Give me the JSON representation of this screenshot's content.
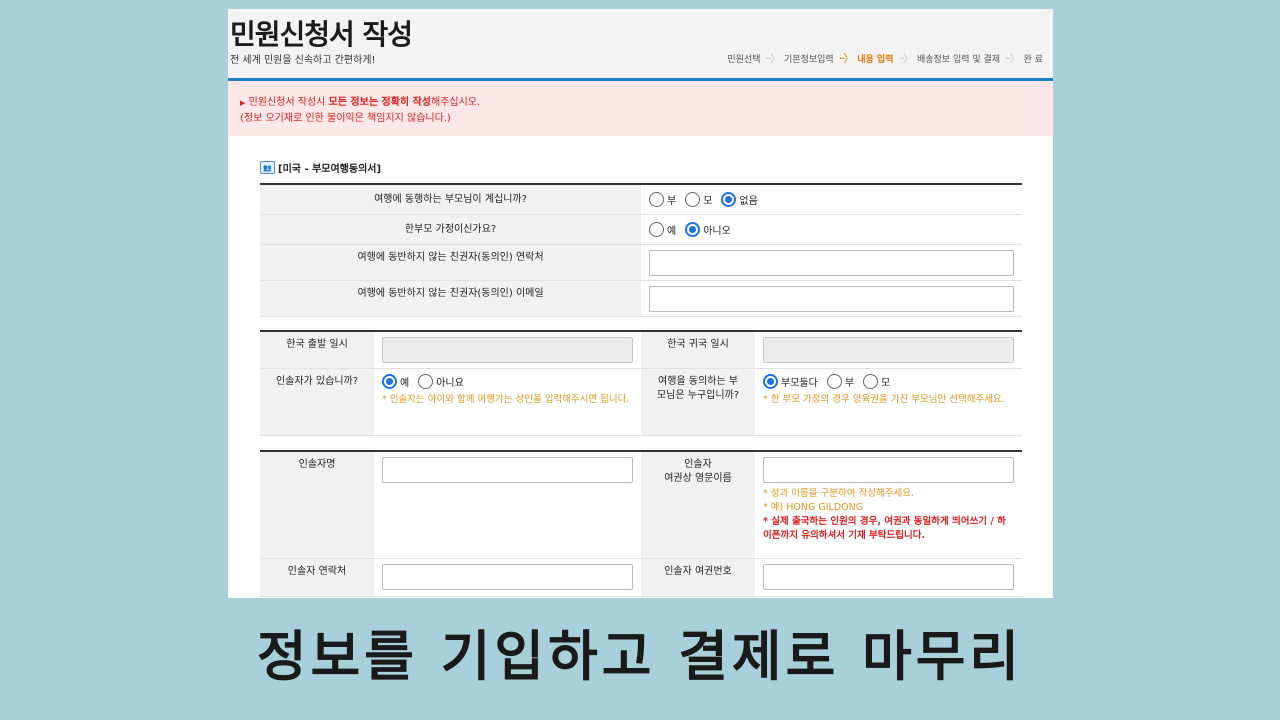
{
  "header": {
    "title": "민원신청서 작성",
    "subtitle": "전 세계 민원을 신속하고 간편하게!",
    "steps": [
      "민원선택",
      "기본정보입력",
      "내용 입력",
      "배송정보 입력 및 결제",
      "완 료"
    ],
    "active_step_index": 2
  },
  "notice": {
    "line1_prefix": "민원신청서 작성시 ",
    "line1_bold": "모든 정보는 정확히 작성",
    "line1_suffix": "해주십시오.",
    "line2": "(정보 오기재로 인한 불이익은 책임지지 않습니다.)"
  },
  "section1": {
    "title": "[미국 - 부모여행동의서]",
    "q1": {
      "label": "여행에 동행하는 부모님이 계십니까?",
      "options": [
        "부",
        "모",
        "없음"
      ],
      "selected": "없음"
    },
    "q2": {
      "label": "한부모 가정이신가요?",
      "options": [
        "예",
        "아니오"
      ],
      "selected": "아니오"
    },
    "q3": {
      "label": "여행에 동반하지 않는 친권자(동의인) 연락처",
      "value": ""
    },
    "q4": {
      "label": "여행에 동반하지 않는 친권자(동의인) 이메일",
      "value": ""
    }
  },
  "section2": {
    "depart_label": "한국 출발 일시",
    "depart_value": "",
    "return_label": "한국 귀국 일시",
    "return_value": "",
    "guardian_q": "인솔자가 있습니까?",
    "guardian_options": [
      "예",
      "아니요"
    ],
    "guardian_selected": "예",
    "guardian_note": "* 인솔자는 아이와 함께 여행가는 성인을 입력해주시면 됩니다.",
    "consent_q": "여행을 동의하는 부모님은 누구입니까?",
    "consent_options": [
      "부모둘다",
      "부",
      "모"
    ],
    "consent_selected": "부모둘다",
    "consent_note": "* 한 부모 가정의 경우 양육권을 가진 부모님만 선택해주세요."
  },
  "section3": {
    "name_label": "인솔자명",
    "name_value": "",
    "eng_label_line1": "인솔자",
    "eng_label_line2": "여권상 영문이름",
    "eng_value": "",
    "eng_note1": "* 성과 이름을 구분하여 작성해주세요.",
    "eng_note2": "* 예) HONG GILDONG",
    "eng_note3": "* 실제 출국하는 인원의 경우, 여권과 동일하게 띄어쓰기 / 하이픈까지 유의하셔서 기재 부탁드립니다.",
    "phone_label": "인솔자 연락처",
    "phone_value": "",
    "passport_label": "인솔자 여권번호",
    "passport_value": ""
  },
  "caption": "정보를 기입하고 결제로 마무리",
  "colors": {
    "accent_blue": "#1d7fc4",
    "active_step": "#e07a00",
    "notice_bg": "#fde7e7",
    "notice_text": "#dd2222",
    "note_orange": "#e6951e",
    "note_red": "#e02020"
  }
}
